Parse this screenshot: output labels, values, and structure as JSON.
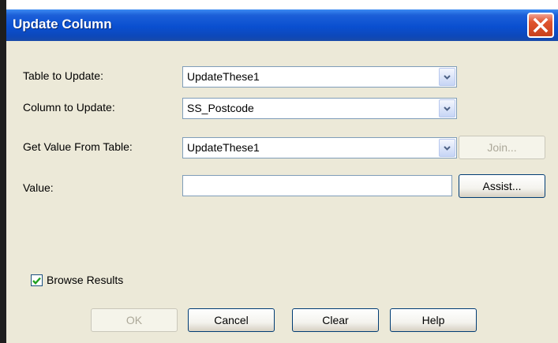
{
  "dialog": {
    "title": "Update Column",
    "close_icon": "close-icon"
  },
  "fields": {
    "table_to_update": {
      "label": "Table to Update:",
      "value": "UpdateThese1"
    },
    "column_to_update": {
      "label": "Column to Update:",
      "value": "SS_Postcode"
    },
    "get_value_from_table": {
      "label": "Get Value From Table:",
      "value": "UpdateThese1"
    },
    "value": {
      "label": "Value:",
      "value": ""
    }
  },
  "buttons": {
    "join": "Join...",
    "assist": "Assist...",
    "ok": "OK",
    "cancel": "Cancel",
    "clear": "Clear",
    "help": "Help"
  },
  "browse_results": {
    "label": "Browse Results",
    "checked": true
  },
  "colors": {
    "titlebar": "#0a4fd0",
    "dialog_bg": "#ece9d8",
    "close_button": "#e0542e",
    "check_mark": "#21a121"
  }
}
